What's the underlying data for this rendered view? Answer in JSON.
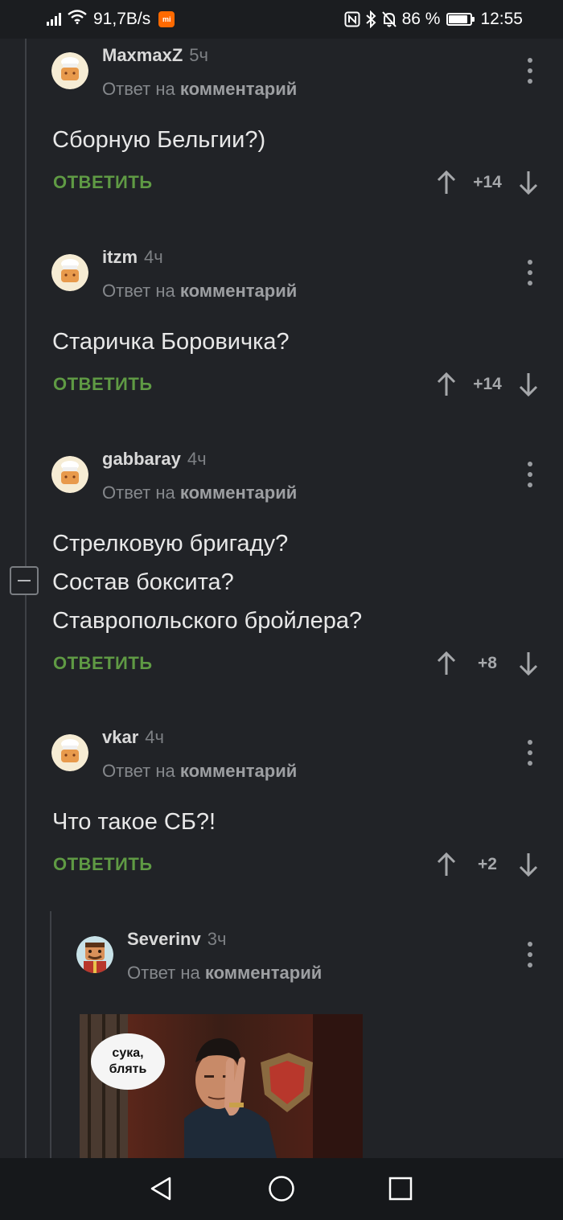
{
  "status_bar": {
    "speed": "91,7B/s",
    "battery_percent": "86 %",
    "battery_level": 0.86,
    "time": "12:55",
    "icons": [
      "signal-icon",
      "wifi-icon",
      "mi-app-icon",
      "nfc-icon",
      "bluetooth-icon",
      "bell-off-icon",
      "battery-icon"
    ]
  },
  "comments": [
    {
      "author": "MaxmaxZ",
      "time": "5ч",
      "reply_prefix": "Ответ на",
      "reply_link": "комментарий",
      "text": [
        "Сборную Бельгии?)"
      ],
      "reply_label": "ОТВЕТИТЬ",
      "score": "+14"
    },
    {
      "author": "itzm",
      "time": "4ч",
      "reply_prefix": "Ответ на",
      "reply_link": "комментарий",
      "text": [
        "Старичка Боровичка?"
      ],
      "reply_label": "ОТВЕТИТЬ",
      "score": "+14"
    },
    {
      "author": "gabbaray",
      "time": "4ч",
      "reply_prefix": "Ответ на",
      "reply_link": "комментарий",
      "text": [
        "Стрелковую бригаду?",
        "Состав боксита?",
        "Ставропольского бройлера?"
      ],
      "reply_label": "ОТВЕТИТЬ",
      "score": "+8"
    },
    {
      "author": "vkar",
      "time": "4ч",
      "reply_prefix": "Ответ на",
      "reply_link": "комментарий",
      "text": [
        "Что такое СБ?!"
      ],
      "reply_label": "ОТВЕТИТЬ",
      "score": "+2"
    },
    {
      "author": "Severinv",
      "time": "3ч",
      "reply_prefix": "Ответ на",
      "reply_link": "комментарий",
      "meme_caption": [
        "сука,",
        "блять"
      ]
    }
  ],
  "colors": {
    "background": "#212327",
    "reply_green": "#5f9a44",
    "author": "#d9d9d9",
    "muted": "#85888c"
  }
}
